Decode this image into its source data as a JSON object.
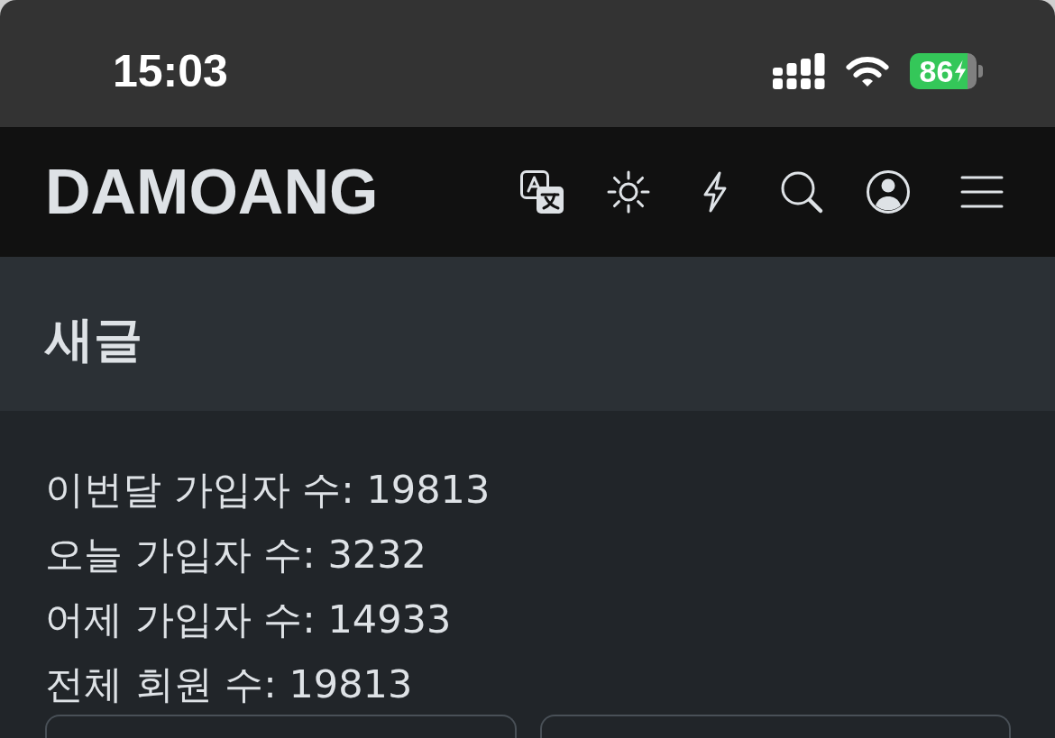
{
  "status_bar": {
    "time": "15:03",
    "battery_percent": "86",
    "charging": true
  },
  "header": {
    "logo": "DAMOANG"
  },
  "section": {
    "title": "새글"
  },
  "stats": [
    "이번달 가입자 수: 19813",
    "오늘 가입자 수: 3232",
    "어제 가입자 수: 14933",
    "전체 회원 수: 19813"
  ]
}
